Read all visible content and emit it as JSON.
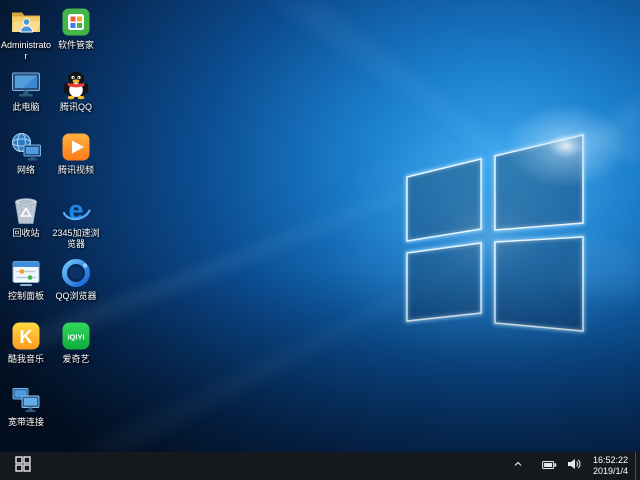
{
  "desktop": {
    "icons": [
      {
        "name": "administrator",
        "label": "Administrator"
      },
      {
        "name": "software-manager",
        "label": "软件管家"
      },
      {
        "name": "this-pc",
        "label": "此电脑"
      },
      {
        "name": "tencent-qq",
        "label": "腾讯QQ"
      },
      {
        "name": "network",
        "label": "网络"
      },
      {
        "name": "tencent-video",
        "label": "腾讯视频"
      },
      {
        "name": "recycle-bin",
        "label": "回收站"
      },
      {
        "name": "2345-browser",
        "label": "2345加速浏览器",
        "glyph": "e"
      },
      {
        "name": "control-panel",
        "label": "控制面板"
      },
      {
        "name": "qq-browser",
        "label": "QQ浏览器"
      },
      {
        "name": "kuwo-music",
        "label": "酷我音乐",
        "glyph": "K"
      },
      {
        "name": "iqiyi",
        "label": "爱奇艺",
        "glyph": "iQIYI"
      },
      {
        "name": "broadband",
        "label": "宽带连接"
      }
    ]
  },
  "taskbar": {
    "start_icon": "windows-logo",
    "tray_icons": [
      "chevron-up-icon",
      "battery-icon",
      "volume-icon"
    ],
    "clock": {
      "time": "16:52:22",
      "date": "2019/1/4"
    }
  },
  "colors": {
    "taskbar_bg": "#15181d",
    "wallpaper_base": "#05142b",
    "wallpaper_glow": "#2e9df2",
    "logo_edge": "#e8f7ff"
  }
}
